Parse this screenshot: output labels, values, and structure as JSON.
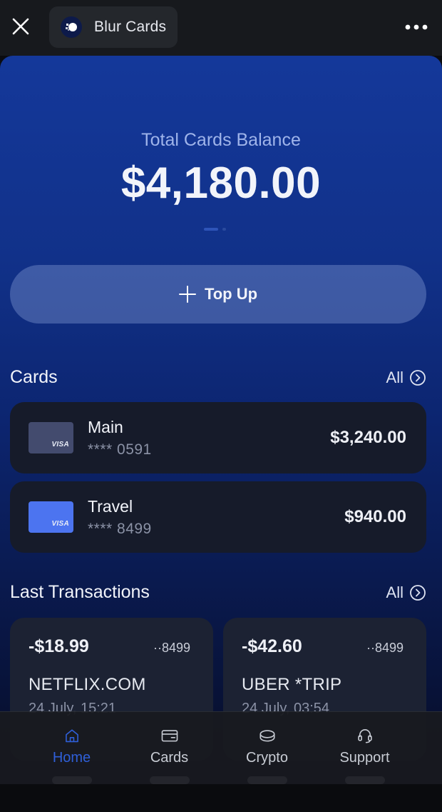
{
  "header": {
    "app_title": "Blur Cards",
    "close_icon": "close-icon",
    "more_icon": "more-horizontal-icon"
  },
  "balance": {
    "label": "Total Cards Balance",
    "value": "$4,180.00"
  },
  "topup": {
    "label": "Top Up"
  },
  "cards_section": {
    "title": "Cards",
    "all_label": "All",
    "items": [
      {
        "name": "Main",
        "number": "**** 0591",
        "amount": "$3,240.00",
        "brand": "VISA",
        "color": "#434b6e"
      },
      {
        "name": "Travel",
        "number": "**** 8499",
        "amount": "$940.00",
        "brand": "VISA",
        "color": "#4c74f0"
      }
    ]
  },
  "transactions_section": {
    "title": "Last Transactions",
    "all_label": "All",
    "items": [
      {
        "amount": "-$18.99",
        "card": "··8499",
        "merchant": "NETFLIX.COM",
        "date": "24 July, 15:21"
      },
      {
        "amount": "-$42.60",
        "card": "··8499",
        "merchant": "UBER *TRIP",
        "date": "24 July, 03:54"
      }
    ]
  },
  "nav": {
    "items": [
      {
        "label": "Home",
        "icon": "home-icon",
        "active": true
      },
      {
        "label": "Cards",
        "icon": "card-icon",
        "active": false
      },
      {
        "label": "Crypto",
        "icon": "coins-icon",
        "active": false
      },
      {
        "label": "Support",
        "icon": "headset-icon",
        "active": false
      }
    ]
  },
  "colors": {
    "accent": "#2f5fd8",
    "panel_top": "#14389a",
    "card_bg": "#161b2a"
  }
}
